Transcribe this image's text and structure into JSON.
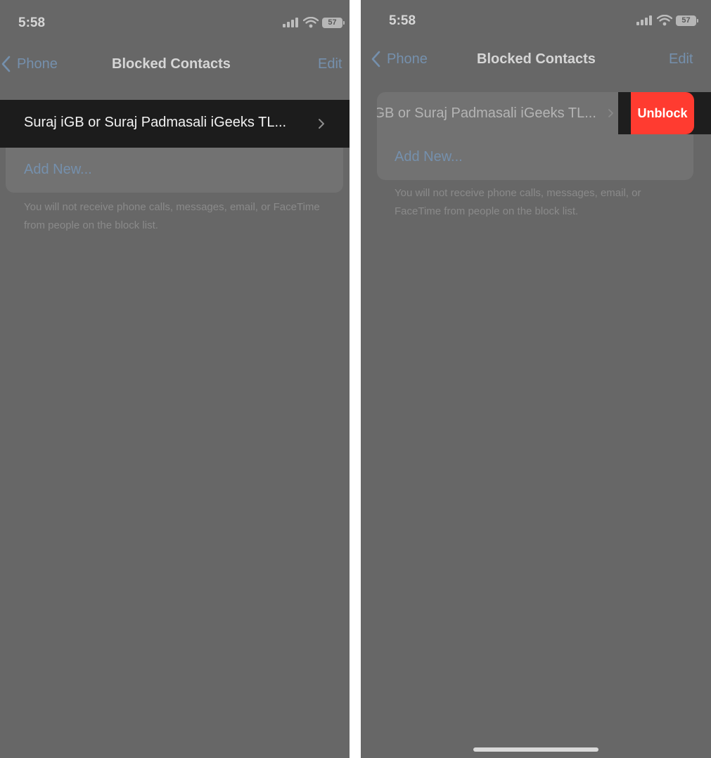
{
  "screens": {
    "left": {
      "status_time": "5:58",
      "battery": "57",
      "nav": {
        "back_label": "Phone",
        "title": "Blocked Contacts",
        "edit_label": "Edit"
      },
      "contact_name": "Suraj iGB or Suraj Padmasali iGeeks TL...",
      "add_new_label": "Add New...",
      "footer_note": "You will not receive phone calls, messages, email, or FaceTime from people on the block list."
    },
    "right": {
      "status_time": "5:58",
      "battery": "57",
      "nav": {
        "back_label": "Phone",
        "title": "Blocked Contacts",
        "edit_label": "Edit"
      },
      "contact_name_partial": "iGB or Suraj Padmasali iGeeks TL...",
      "unblock_label": "Unblock",
      "add_new_label": "Add New...",
      "footer_note": "You will not receive phone calls, messages, email, or FaceTime from people on the block list."
    }
  },
  "colors": {
    "screen_bg": "#676767",
    "link": "#7590ad",
    "highlight_row": "#1c1c1c",
    "unblock_red": "#ff3b30",
    "divider": "#ffffff"
  },
  "icons": [
    "cellular-signal-icon",
    "wifi-icon",
    "battery-icon",
    "chevron-left-icon",
    "chevron-right-icon"
  ]
}
